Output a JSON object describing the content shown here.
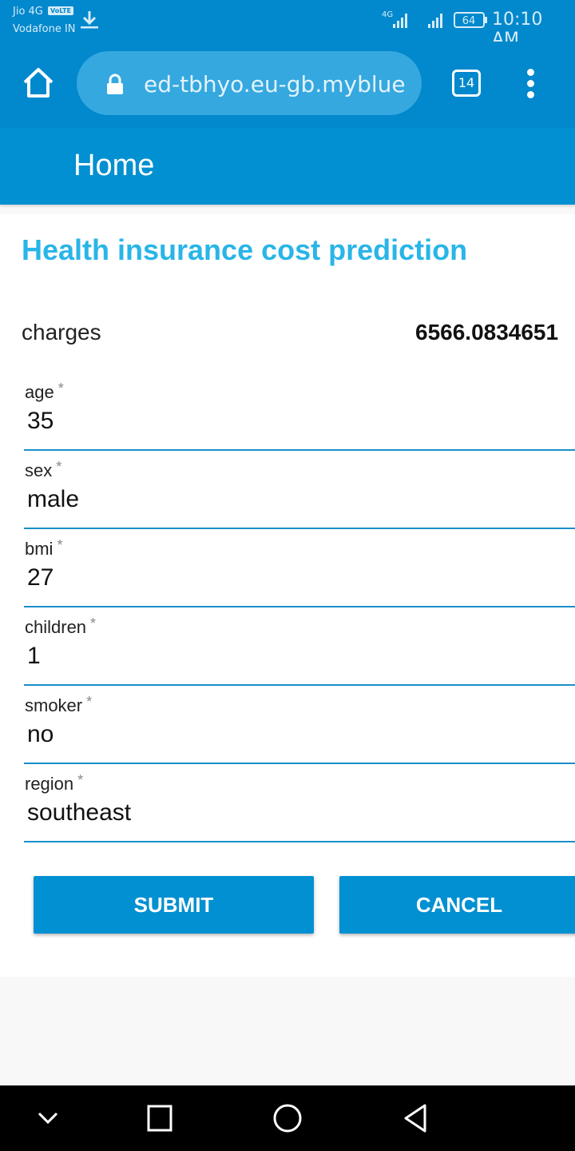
{
  "status_bar": {
    "carrier1": "Jio 4G",
    "volte": "VoLTE",
    "carrier2": "Vodafone IN",
    "network_type": "4G",
    "battery": "64",
    "time": "10:10 AM"
  },
  "browser": {
    "url": "ed-tbhyo.eu-gb.mybluemix.net",
    "tab_count": "14"
  },
  "app": {
    "header_title": "Home",
    "page_title": "Health insurance cost prediction",
    "charges_label": "charges",
    "charges_value": "6566.0834651"
  },
  "fields": [
    {
      "label": "age",
      "value": "35"
    },
    {
      "label": "sex",
      "value": "male"
    },
    {
      "label": "bmi",
      "value": "27"
    },
    {
      "label": "children",
      "value": "1"
    },
    {
      "label": "smoker",
      "value": "no"
    },
    {
      "label": "region",
      "value": "southeast"
    }
  ],
  "required_marker": "*",
  "buttons": {
    "submit": "SUBMIT",
    "cancel": "CANCEL"
  },
  "colors": {
    "primary": "#0190d1",
    "title_accent": "#29b5e8"
  }
}
